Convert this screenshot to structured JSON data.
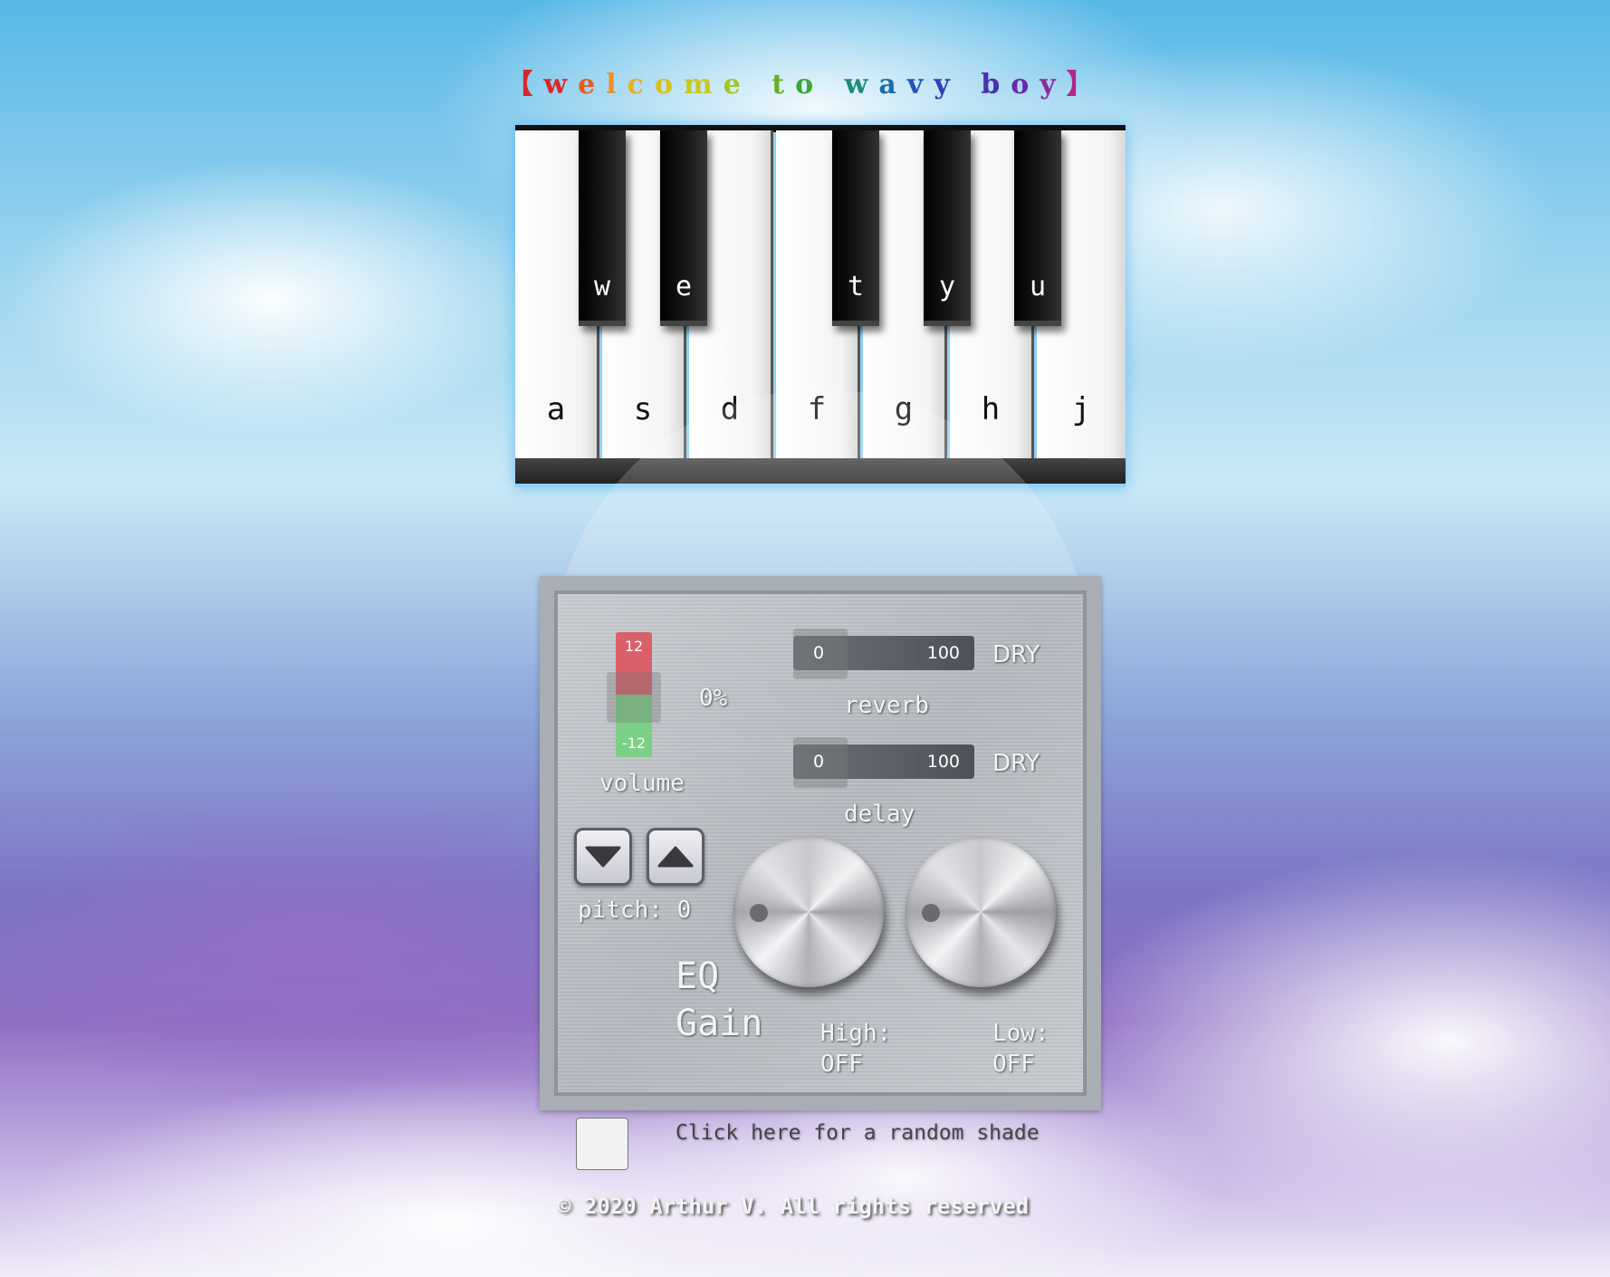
{
  "header": {
    "title_parts": [
      {
        "text": "【",
        "color": "#d62828"
      },
      {
        "text": "w",
        "color": "#d62828"
      },
      {
        "text": "e",
        "color": "#e85d1c"
      },
      {
        "text": "l",
        "color": "#ef8f22"
      },
      {
        "text": "c",
        "color": "#e8b21a"
      },
      {
        "text": "o",
        "color": "#d8c21a"
      },
      {
        "text": "m",
        "color": "#c9c71a"
      },
      {
        "text": "e",
        "color": "#a7c41e"
      },
      {
        "text": " ",
        "color": "#000000"
      },
      {
        "text": "t",
        "color": "#6cae2a"
      },
      {
        "text": "o",
        "color": "#3aa63a"
      },
      {
        "text": " ",
        "color": "#000000"
      },
      {
        "text": "w",
        "color": "#1f8a7a"
      },
      {
        "text": "a",
        "color": "#1c6fa8"
      },
      {
        "text": "v",
        "color": "#2554b8"
      },
      {
        "text": "y",
        "color": "#2f3eb8"
      },
      {
        "text": " ",
        "color": "#000000"
      },
      {
        "text": "b",
        "color": "#4b30b0"
      },
      {
        "text": "o",
        "color": "#6a2aa8"
      },
      {
        "text": "y",
        "color": "#8a2a9e"
      },
      {
        "text": "】",
        "color": "#b0288c"
      }
    ]
  },
  "piano": {
    "white_keys": [
      "a",
      "s",
      "d",
      "f",
      "g",
      "h",
      "j"
    ],
    "black_keys": [
      "w",
      "e",
      "t",
      "y",
      "u"
    ]
  },
  "controls": {
    "volume": {
      "label": "volume",
      "value": "0%",
      "max": "12",
      "min": "-12"
    },
    "reverb": {
      "label": "reverb",
      "min": "0",
      "max": "100",
      "mode": "DRY"
    },
    "delay": {
      "label": "delay",
      "min": "0",
      "max": "100",
      "mode": "DRY"
    },
    "pitch": {
      "label": "pitch: 0"
    },
    "eq": {
      "line1": "EQ",
      "line2": "Gain",
      "high_label": "High:",
      "high_value": "OFF",
      "low_label": "Low:",
      "low_value": "OFF"
    }
  },
  "shade": {
    "label": "Click here for a random shade"
  },
  "footer": {
    "text": "© 2020 Arthur V. All rights reserved"
  }
}
